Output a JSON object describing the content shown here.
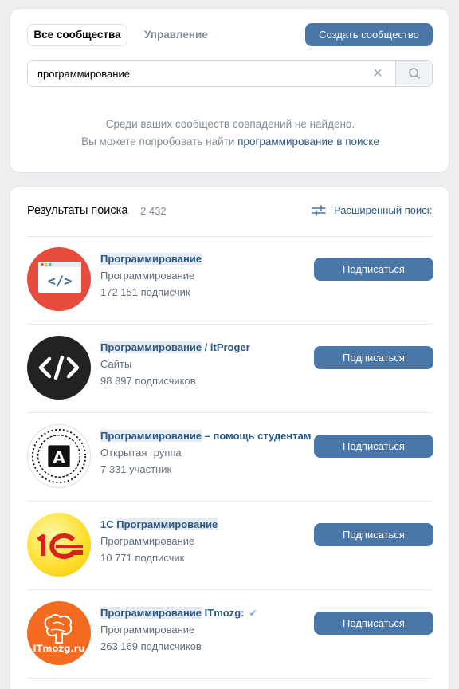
{
  "tabs": {
    "all": "Все сообщества",
    "manage": "Управление"
  },
  "create_button": "Создать сообщество",
  "search": {
    "value": "программирование",
    "placeholder": ""
  },
  "empty": {
    "line1": "Среди ваших сообществ совпадений не найдено.",
    "line2_prefix": "Вы можете попробовать найти ",
    "line2_link": "программирование в поиске"
  },
  "results": {
    "title": "Результаты поиска",
    "count": "2 432",
    "advanced": "Расширенный поиск",
    "subscribe_label": "Подписаться",
    "items": [
      {
        "name_hl": "Программирование",
        "name_rest": "",
        "category": "Программирование",
        "members": "172 151 подписчик",
        "avatar": "code-window-icon"
      },
      {
        "name_hl": "Программирование",
        "name_rest": " / itProger",
        "category": "Сайты",
        "members": "98 897 подписчиков",
        "avatar": "code-brackets-icon"
      },
      {
        "name_hl": "Программирование",
        "name_rest": " – помощь студентам",
        "category": "Открытая группа",
        "members": "7 331 участник",
        "avatar": "chip-a-icon"
      },
      {
        "name_pre": "1С ",
        "name_hl": "Программирование",
        "name_rest": "",
        "category": "Программирование",
        "members": "10 771 подписчик",
        "avatar": "1c-logo"
      },
      {
        "name_hl": "Программирование",
        "name_rest": " ITmozg:",
        "category": "Программирование",
        "members": "263 169 подписчиков",
        "avatar": "itmozg-logo",
        "verified": true
      }
    ]
  },
  "colors": {
    "accent": "#4a76a8",
    "link": "#2a5885",
    "bg": "#edeef0"
  }
}
